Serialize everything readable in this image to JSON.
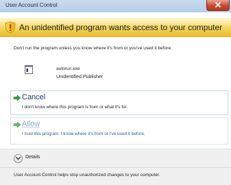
{
  "window": {
    "title": "User Account Control"
  },
  "banner": {
    "message": "An unidentified program wants access to your computer",
    "icon": "shield-warning-icon"
  },
  "body": {
    "intro": "Don't run the program unless you know where it's from or you've used it before.",
    "program": {
      "name": "autorun.exe",
      "publisher": "Unidentified Publisher",
      "icon": "program-icon"
    }
  },
  "options": {
    "cancel": {
      "title": "Cancel",
      "description": "I don't know where this program is from or what it's for.",
      "icon": "green-arrow-icon"
    },
    "allow": {
      "title": "Allow",
      "description": "I trust this program. I know where it's from or I've used it before.",
      "icon": "green-arrow-icon"
    }
  },
  "footer": {
    "details_label": "Details",
    "info": "User Account Control helps stop unauthorized changes to your computer."
  },
  "colors": {
    "banner": "#f4d35b",
    "link": "#153a73",
    "close": "#c74a2d"
  }
}
